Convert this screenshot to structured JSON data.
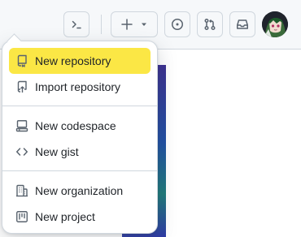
{
  "header": {
    "command_palette_icon": "terminal-icon",
    "create_icon": "plus-icon",
    "create_caret_icon": "triangle-down-icon",
    "issues_icon": "issue-opened-icon",
    "pull_requests_icon": "git-pull-request-icon",
    "inbox_icon": "inbox-icon",
    "avatar": "user-avatar"
  },
  "menu": {
    "groups": [
      {
        "items": [
          {
            "label": "New repository",
            "icon": "repo-icon",
            "active": true
          },
          {
            "label": "Import repository",
            "icon": "repo-push-icon",
            "active": false
          }
        ]
      },
      {
        "items": [
          {
            "label": "New codespace",
            "icon": "codespaces-icon",
            "active": false
          },
          {
            "label": "New gist",
            "icon": "code-icon",
            "active": false
          }
        ]
      },
      {
        "items": [
          {
            "label": "New organization",
            "icon": "organization-icon",
            "active": false
          },
          {
            "label": "New project",
            "icon": "project-icon",
            "active": false
          }
        ]
      }
    ]
  },
  "colors": {
    "highlight": "#fbe745",
    "border": "#d0d7de",
    "text": "#1f2328",
    "muted": "#59636e"
  }
}
